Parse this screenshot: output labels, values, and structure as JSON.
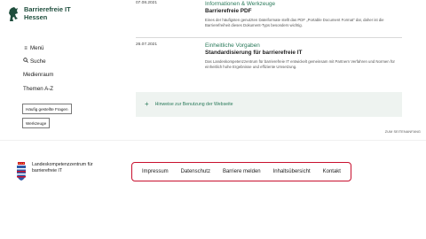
{
  "header": {
    "title_line1": "Barrierefreie IT",
    "title_line2": "Hessen",
    "logo_icon": "hessen-lion-icon"
  },
  "nav": {
    "menu": "Menü",
    "search": "Suche",
    "media": "Medienraum",
    "topics": "Themen A-Z",
    "faq_button": "Häufig gestellte Fragen",
    "tools_button": "Werkzeuge"
  },
  "entries": [
    {
      "date": "07.08.2021",
      "kicker": "Informationen & Werkzeuge",
      "title": "Barrierefreie PDF",
      "desc": "Eines der häufigsten genutzten Dateiformate stellt das PDF „Portable Document Format“ dar, daher ist die Barrierefreiheit dieses Dokument-Typs besonders wichtig."
    },
    {
      "date": "26.07.2021",
      "kicker": "Einheitliche Vorgaben",
      "title": "Standardisierung für barrierefreie IT",
      "desc": "Das Landeskompetenzzentrum für barrierefreie IT entwickelt gemeinsam mit Partnern Verfahren und Normen für einheitlich hohe Ergebnisse und effiziente Umsetzung."
    }
  ],
  "notes": {
    "plus": "+",
    "label": "Hinweise zur Benutzung der Webseite"
  },
  "back_to_top": "ZUM SEITENANFANG",
  "footer": {
    "org_line1": "Landeskompetenzzentrum für",
    "org_line2": "barrierefreie IT",
    "links": [
      "Impressum",
      "Datenschutz",
      "Barriere melden",
      "Inhaltsübersicht",
      "Kontakt"
    ],
    "accent": "#c8102e"
  }
}
